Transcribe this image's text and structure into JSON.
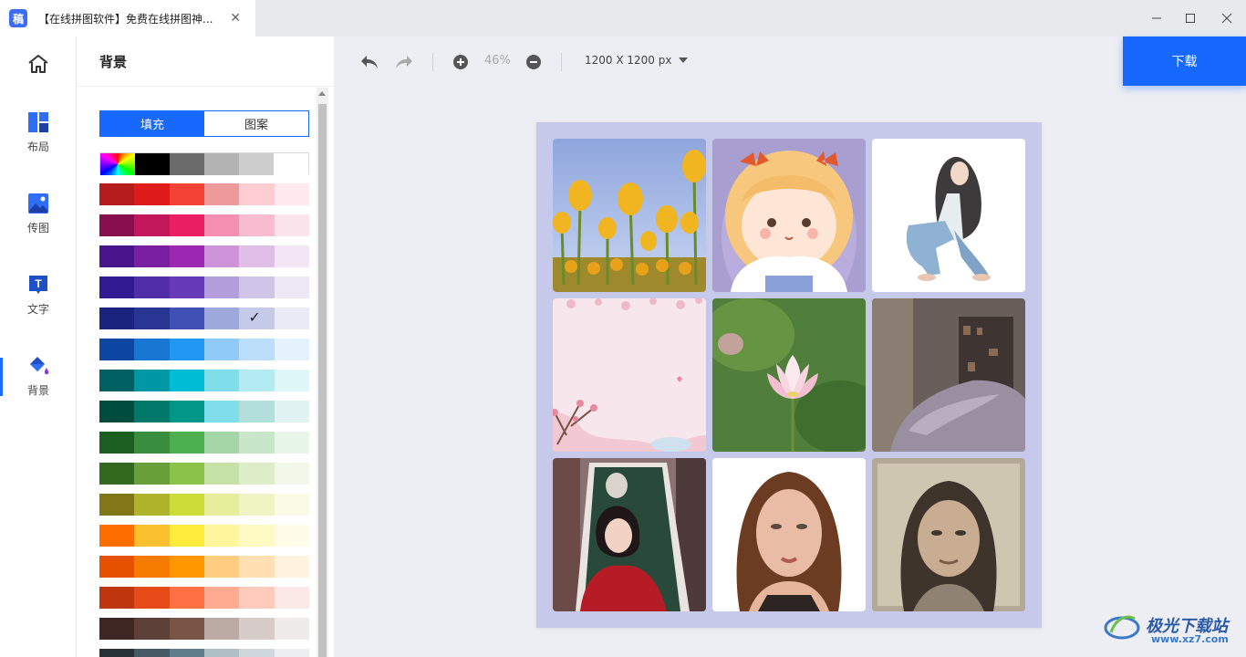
{
  "window": {
    "tab_title": "【在线拼图软件】免费在线拼图神...",
    "app_logo_char": "稿",
    "controls": [
      "minimize",
      "maximize",
      "close"
    ]
  },
  "nav": {
    "items": [
      {
        "label": "",
        "icon": "home-icon"
      },
      {
        "label": "布局",
        "icon": "layout-icon"
      },
      {
        "label": "传图",
        "icon": "upload-image-icon"
      },
      {
        "label": "文字",
        "icon": "text-icon"
      },
      {
        "label": "背景",
        "icon": "paint-bucket-icon",
        "active": true
      }
    ]
  },
  "panel": {
    "title": "背景",
    "tabs": [
      {
        "label": "填充",
        "active": true
      },
      {
        "label": "图案",
        "active": false
      }
    ],
    "palette": [
      [
        "rainbow",
        "#000000",
        "#6b6b6b",
        "#b3b3b3",
        "#cdcdcd",
        "#ffffff"
      ],
      [
        "#b71c1c",
        "#e01b1b",
        "#f44336",
        "#ef9a9a",
        "#ffcdd2",
        "#ffebee"
      ],
      [
        "#880e4f",
        "#c2185b",
        "#e91e63",
        "#f48fb1",
        "#f8bbd0",
        "#fce4ec"
      ],
      [
        "#4a148c",
        "#7b1fa2",
        "#9c27b0",
        "#ce93d8",
        "#e1bee7",
        "#f3e5f5"
      ],
      [
        "#311b92",
        "#512da8",
        "#673ab7",
        "#b39ddb",
        "#d1c4e9",
        "#ede7f6"
      ],
      [
        "#1a237e",
        "#283593",
        "#3f51b5",
        "#9fa8da",
        "#c5cae9",
        "#e8eaf6"
      ],
      [
        "#0d47a1",
        "#1976d2",
        "#2196f3",
        "#90caf9",
        "#bbdefb",
        "#e3f2fd"
      ],
      [
        "#006064",
        "#0097a7",
        "#00bcd4",
        "#80deea",
        "#b2ebf2",
        "#e0f7fa"
      ],
      [
        "#004d40",
        "#00796b",
        "#009688",
        "#80deea",
        "#b2dfdb",
        "#e0f2f1"
      ],
      [
        "#1b5e20",
        "#388e3c",
        "#4caf50",
        "#a5d6a7",
        "#c8e6c9",
        "#e8f5e9"
      ],
      [
        "#33691e",
        "#689f38",
        "#8bc34a",
        "#c5e1a5",
        "#dcedc8",
        "#f1f8e9"
      ],
      [
        "#827717",
        "#afb42b",
        "#cddc39",
        "#e6ee9c",
        "#f0f4c3",
        "#f9fbe7"
      ],
      [
        "#ff6f00",
        "#fbc02d",
        "#ffeb3b",
        "#fff59d",
        "#fff9c4",
        "#fffde7"
      ],
      [
        "#e65100",
        "#f57c00",
        "#ff9800",
        "#ffcc80",
        "#ffe0b2",
        "#fff3e0"
      ],
      [
        "#bf360c",
        "#e64a19",
        "#ff7043",
        "#ffab91",
        "#ffccbc",
        "#fbe9e7"
      ],
      [
        "#3e2723",
        "#5d4037",
        "#795548",
        "#bcaaa4",
        "#d7ccc8",
        "#efebe9"
      ],
      [
        "#263238",
        "#455a64",
        "#607d8b",
        "#b0bec5",
        "#cfd8dc",
        "#eceff1"
      ]
    ],
    "selected": {
      "row": 5,
      "col": 4
    }
  },
  "toolbar": {
    "zoom": "46%",
    "canvas_size": "1200 X 1200 px",
    "download_label": "下载"
  },
  "canvas": {
    "background": "#c7c9ea",
    "photos": [
      "tulips-photo",
      "cartoon-girl-illustration",
      "sitting-girl-sketch",
      "pink-blossom-background",
      "lotus-flower-photo",
      "bedroom-photo",
      "woman-red-dress-photo",
      "woman-portrait-photo",
      "vintage-portrait-photo"
    ]
  },
  "watermark": {
    "text": "极光下载站",
    "sub": "www.xz7.com"
  }
}
